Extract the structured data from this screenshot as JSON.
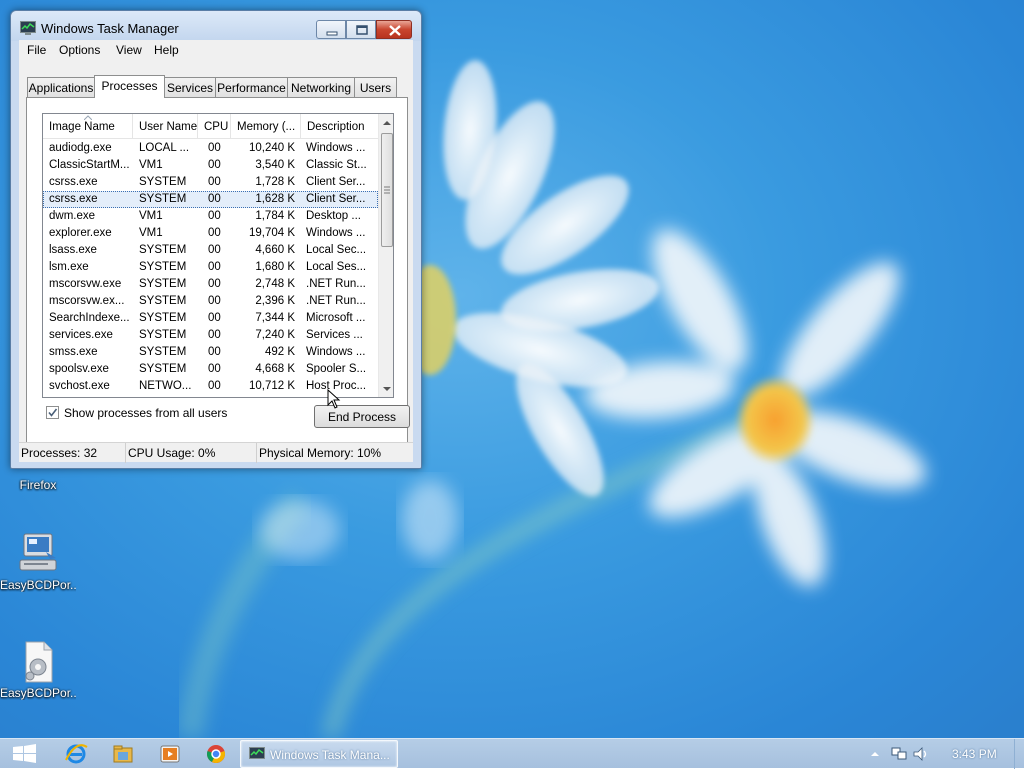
{
  "window": {
    "title": "Windows Task Manager",
    "menu": [
      "File",
      "Options",
      "View",
      "Help"
    ],
    "tabs": [
      "Applications",
      "Processes",
      "Services",
      "Performance",
      "Networking",
      "Users"
    ],
    "active_tab": "Processes"
  },
  "processes": {
    "columns": [
      "Image Name",
      "User Name",
      "CPU",
      "Memory (...",
      "Description"
    ],
    "rows": [
      {
        "name": "audiodg.exe",
        "user": "LOCAL ...",
        "cpu": "00",
        "mem": "10,240 K",
        "desc": "Windows ..."
      },
      {
        "name": "ClassicStartM...",
        "user": "VM1",
        "cpu": "00",
        "mem": "3,540 K",
        "desc": "Classic St..."
      },
      {
        "name": "csrss.exe",
        "user": "SYSTEM",
        "cpu": "00",
        "mem": "1,728 K",
        "desc": "Client Ser..."
      },
      {
        "name": "csrss.exe",
        "user": "SYSTEM",
        "cpu": "00",
        "mem": "1,628 K",
        "desc": "Client Ser...",
        "selected": true
      },
      {
        "name": "dwm.exe",
        "user": "VM1",
        "cpu": "00",
        "mem": "1,784 K",
        "desc": "Desktop ..."
      },
      {
        "name": "explorer.exe",
        "user": "VM1",
        "cpu": "00",
        "mem": "19,704 K",
        "desc": "Windows ..."
      },
      {
        "name": "lsass.exe",
        "user": "SYSTEM",
        "cpu": "00",
        "mem": "4,660 K",
        "desc": "Local Sec..."
      },
      {
        "name": "lsm.exe",
        "user": "SYSTEM",
        "cpu": "00",
        "mem": "1,680 K",
        "desc": "Local Ses..."
      },
      {
        "name": "mscorsvw.exe",
        "user": "SYSTEM",
        "cpu": "00",
        "mem": "2,748 K",
        "desc": ".NET Run..."
      },
      {
        "name": "mscorsvw.ex...",
        "user": "SYSTEM",
        "cpu": "00",
        "mem": "2,396 K",
        "desc": ".NET Run..."
      },
      {
        "name": "SearchIndexe...",
        "user": "SYSTEM",
        "cpu": "00",
        "mem": "7,344 K",
        "desc": "Microsoft ..."
      },
      {
        "name": "services.exe",
        "user": "SYSTEM",
        "cpu": "00",
        "mem": "7,240 K",
        "desc": "Services ..."
      },
      {
        "name": "smss.exe",
        "user": "SYSTEM",
        "cpu": "00",
        "mem": "492 K",
        "desc": "Windows ..."
      },
      {
        "name": "spoolsv.exe",
        "user": "SYSTEM",
        "cpu": "00",
        "mem": "4,668 K",
        "desc": "Spooler S..."
      },
      {
        "name": "svchost.exe",
        "user": "NETWO...",
        "cpu": "00",
        "mem": "10,712 K",
        "desc": "Host Proc..."
      }
    ],
    "show_all_label": "Show processes from all users",
    "show_all_checked": true,
    "end_process_label": "End Process"
  },
  "statusbar": {
    "processes": "Processes: 32",
    "cpu": "CPU Usage: 0%",
    "memory": "Physical Memory: 10%"
  },
  "desktop": {
    "icons": [
      {
        "label": "Firefox",
        "icon": "firefox-icon"
      },
      {
        "label": "EasyBCDPor...",
        "icon": "easybcd-computer-icon"
      },
      {
        "label": "EasyBCDPor...",
        "icon": "settings-file-icon"
      }
    ]
  },
  "taskbar": {
    "pinned": [
      "internet-explorer-icon",
      "file-explorer-icon",
      "media-player-icon",
      "chrome-icon"
    ],
    "active_window_label": "Windows Task Mana...",
    "clock": "3:43 PM"
  },
  "colors": {
    "desktop": "#3a9be0",
    "taskbar": "#afc7e3",
    "window_frame": "#c9daf0",
    "close_button": "#c9452f",
    "selection": "#e4eefa"
  }
}
